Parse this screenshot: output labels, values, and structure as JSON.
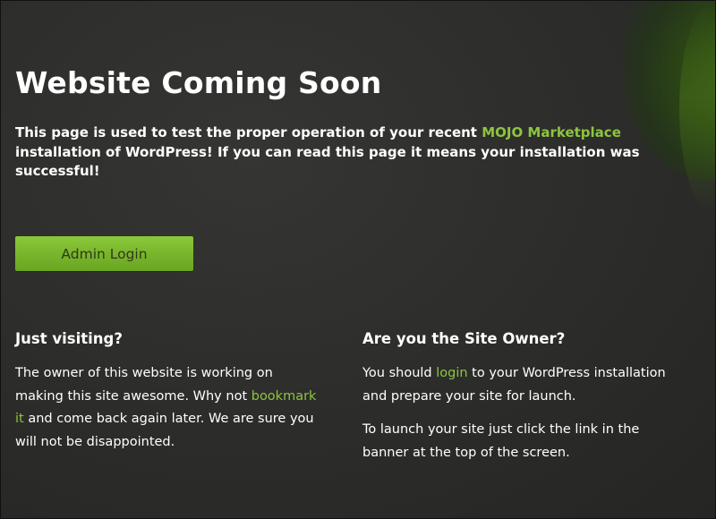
{
  "page": {
    "title": "Website Coming Soon",
    "intro_before": "This page is used to test the proper operation of your recent ",
    "intro_link": "MOJO Marketplace",
    "intro_after": " installation of WordPress! If you can read this page it means your installation was successful!",
    "admin_button": "Admin Login"
  },
  "visiting": {
    "heading": "Just visiting?",
    "text_before": "The owner of this website is working on making this site awesome. Why not ",
    "link": "bookmark it",
    "text_after": " and come back again later. We are sure you will not be disappointed."
  },
  "owner": {
    "heading": "Are you the Site Owner?",
    "p1_before": "You should ",
    "p1_link": "login",
    "p1_after": " to your WordPress installation and prepare your site for launch.",
    "p2": "To launch your site just click the link in the banner at the top of the screen."
  },
  "colors": {
    "background": "#2b2b29",
    "accent": "#8cc63f",
    "button": "#7ab52c",
    "text": "#ffffff"
  }
}
